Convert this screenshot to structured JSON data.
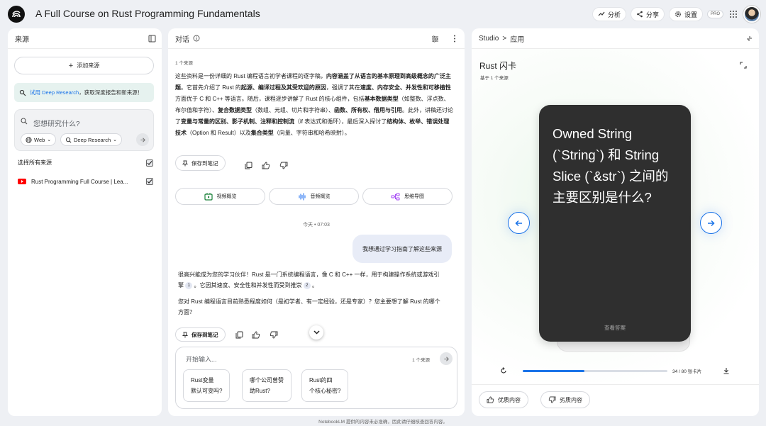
{
  "app": {
    "title": "A Full Course on Rust Programming Fundamentals",
    "actions": {
      "analyze": "分析",
      "share": "分享",
      "settings": "设置",
      "pro": "PRO"
    }
  },
  "sources": {
    "title": "来源",
    "add_label": "添加来源",
    "banner_link": "试用 Deep Research",
    "banner_text": "，获取深度报告和新来源！",
    "search_placeholder": "您想研究什么?",
    "chip_web": "Web",
    "chip_research": "Deep Research",
    "select_all": "选择所有来源",
    "items": [
      {
        "title": "Rust Programming Full Course | Lea..."
      }
    ]
  },
  "chat": {
    "title": "对话",
    "source_count": "1 个来源",
    "summary": [
      {
        "t": "这些资料是一份详细的 Rust 编程语言初学者课程的逐字稿，"
      },
      {
        "t": "内容涵盖了从语言的基本原理到高级概念的广泛主题",
        "b": true
      },
      {
        "t": "。它首先介绍了 Rust 的"
      },
      {
        "t": "起源、编译过程及其受欢迎的原因",
        "b": true
      },
      {
        "t": "，强调了其在"
      },
      {
        "t": "速度、内存安全、并发性和可移植性",
        "b": true
      },
      {
        "t": "方面优于 C 和 C++ 等语言。随后，课程逐步讲解了 Rust 的核心组件，包括"
      },
      {
        "t": "基本数据类型",
        "b": true
      },
      {
        "t": "（如整数、浮点数、布尔值和字符）、"
      },
      {
        "t": "复合数据类型",
        "b": true
      },
      {
        "t": "（数组、元组、切片和字符串）、"
      },
      {
        "t": "函数、所有权、借用与引用",
        "b": true
      },
      {
        "t": "。此外，讲稿还讨论了"
      },
      {
        "t": "变量与常量的区别、影子机制、注释和控制流",
        "b": true
      },
      {
        "t": "（if 表达式和循环），最后深入探讨了"
      },
      {
        "t": "结构体、枚举、错误处理技术",
        "b": true
      },
      {
        "t": "（Option 和 Result）以及"
      },
      {
        "t": "集合类型",
        "b": true
      },
      {
        "t": "（向量、字符串和哈希映射）。"
      }
    ],
    "save_note": "保存到笔记",
    "overviews": {
      "video": "视频概览",
      "audio": "音频概览",
      "mindmap": "思维导图"
    },
    "timestamp": "今天 • 07:03",
    "user_message": "我想通过学习指南了解这些来源",
    "reply_1a": "很高兴能成为您的学习伙伴！Rust 是一门系统编程语言，像 C 和 C++ 一样，用于构建操作系统或游戏引擎",
    "cite_1": "1",
    "reply_1b": "。它因其速度、安全性和并发性而受到推崇",
    "cite_2": "2",
    "reply_1c": "。",
    "reply_2": "您对 Rust 编程语言目前熟悉程度如何（是初学者、有一定经验，还是专家）？您主要想了解 Rust 的哪个方面？",
    "save_note_bottom": "保存到笔记",
    "compose_placeholder": "开始输入...",
    "compose_source_count": "1 个来源",
    "suggestions": [
      {
        "l1": "Rust变量",
        "l2": "默认可变吗?"
      },
      {
        "l1": "哪个公司曾赞",
        "l2": "助Rust?"
      },
      {
        "l1": "Rust的四",
        "l2": "个核心秘密?"
      }
    ]
  },
  "studio": {
    "breadcrumb_root": "Studio",
    "breadcrumb_sep": ">",
    "breadcrumb_page": "应用",
    "flashcards_title": "Rust 闪卡",
    "flashcards_sub": "基于 1 个来源",
    "question": "Owned String (`String`) 和 String Slice (`&str`) 之间的主要区别是什么?",
    "show_answer": "查看答案",
    "progress_current": 34,
    "progress_total": 80,
    "progress_label": "34 / 80 张卡片",
    "good_content": "优质内容",
    "bad_content": "劣质内容"
  },
  "footer": "NotebookLM 提供的内容未必准确，因此请仔细核查回答内容。",
  "colors": {
    "accent": "#1a73e8",
    "card": "#2f2f2f",
    "page_bg": "#eef0f4"
  }
}
